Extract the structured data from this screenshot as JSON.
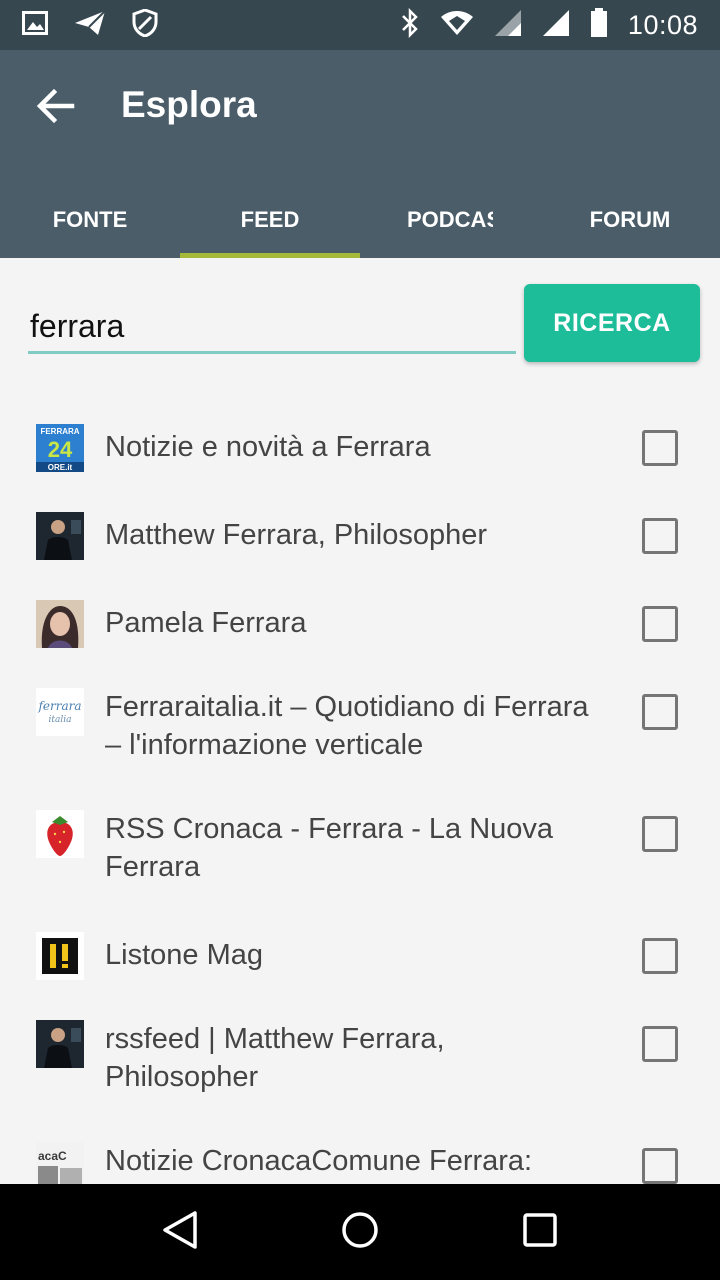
{
  "status": {
    "time": "10:08"
  },
  "appbar": {
    "title": "Esplora"
  },
  "tabs": [
    {
      "label": "FONTE"
    },
    {
      "label": "FEED",
      "active": true
    },
    {
      "label": "PODCAST"
    },
    {
      "label": "FORUM"
    }
  ],
  "search": {
    "value": "ferrara",
    "button_label": "RICERCA"
  },
  "results": [
    {
      "title": "Notizie e novità a Ferrara",
      "checked": false
    },
    {
      "title": "Matthew Ferrara, Philosopher",
      "checked": false
    },
    {
      "title": "Pamela Ferrara",
      "checked": false
    },
    {
      "title": "Ferraraitalia.it – Quotidiano di Ferrara – l'informazione verticale",
      "checked": false
    },
    {
      "title": "RSS Cronaca - Ferrara - La Nuova Ferrara",
      "checked": false
    },
    {
      "title": "Listone Mag",
      "checked": false
    },
    {
      "title": "rssfeed | Matthew Ferrara, Philosopher",
      "checked": false
    },
    {
      "title": "Notizie CronacaComune Ferrara:",
      "checked": false
    }
  ],
  "thumb_labels": {
    "ferrara24_top": "FERRARA",
    "ferrara24_mid": "24",
    "ferrara24_bot": "ORE.it",
    "ferraraitalia": "ferrara",
    "ferraraitalia_sub": "italia",
    "cronaca": "acaC"
  },
  "colors": {
    "status_bar": "#37474f",
    "app_bar": "#4a5d69",
    "accent_underline": "#a4b83a",
    "search_button": "#1ebd9a",
    "input_line": "#80cbc4"
  }
}
